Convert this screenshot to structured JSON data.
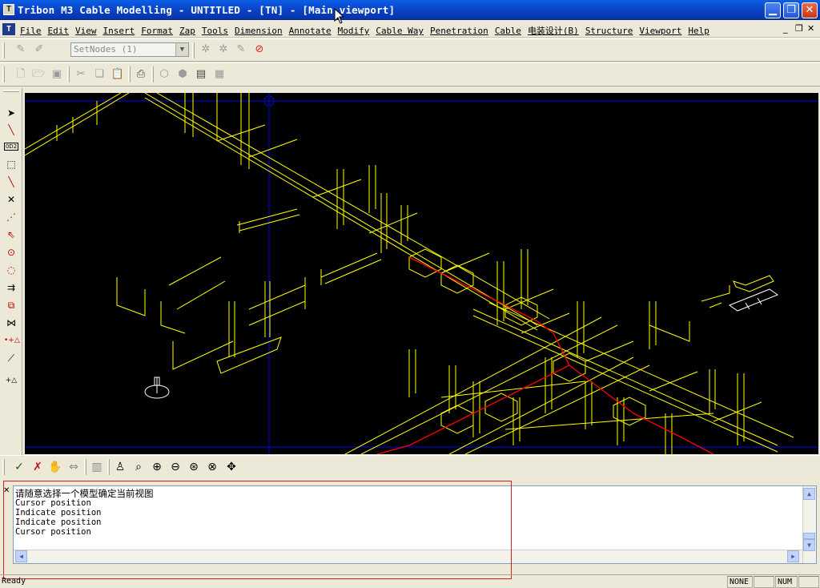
{
  "window": {
    "title": "Tribon M3 Cable Modelling - UNTITLED - [TN] - [Main viewport]",
    "minimize_label": "▁",
    "restore_label": "❐",
    "close_label": "✕"
  },
  "menubar": {
    "items": [
      "File",
      "Edit",
      "View",
      "Insert",
      "Format",
      "Zap",
      "Tools",
      "Dimension",
      "Annotate",
      "Modify",
      "Cable Way",
      "Penetration",
      "Cable",
      "电装设计(B)",
      "Structure",
      "Viewport",
      "Help"
    ],
    "mdi_min": "_",
    "mdi_restore": "❐",
    "mdi_close": "✕"
  },
  "toolbar1": {
    "setnodes_value": "SetNodes (1)",
    "icons": [
      "pencil-disabled-icon",
      "setnodes-dropdown",
      "gear-disabled-icon",
      "gear-disabled-icon-2",
      "pencil-disabled-icon-2",
      "stop-icon"
    ]
  },
  "toolbar2": {
    "icons": [
      "new-file-icon",
      "open-folder-icon",
      "save-icon",
      "cut-icon",
      "copy-icon",
      "paste-icon",
      "print-icon",
      "cube-icon",
      "cubes-icon",
      "properties-icon",
      "table-icon"
    ]
  },
  "left_tools": [
    "select-arrow-icon",
    "line-tool-icon",
    "dimension-icon",
    "box-icon",
    "line-diagonal-icon",
    "cross-icon",
    "node-icon",
    "node-arrow-icon",
    "point-circle-icon",
    "arc-icon",
    "arrows-icon",
    "rectangle-icon",
    "split-icon",
    "add-delta-icon",
    "wand-icon",
    "add-delta-icon-2"
  ],
  "bottom_toolbar": {
    "icons": [
      "ok-check-icon",
      "cancel-x-icon",
      "pan-hand-icon",
      "link-icon",
      "grid-icon",
      "brush-icon",
      "zoom-window-icon",
      "zoom-in-icon",
      "zoom-out-icon",
      "zoom-extents-icon",
      "zoom-previous-icon",
      "move-icon"
    ]
  },
  "command_log": {
    "lines": [
      "请随意选择一个模型确定当前视图",
      "Cursor position",
      "Indicate position",
      "Indicate position",
      "Cursor position"
    ]
  },
  "status": {
    "left": "Ready",
    "pane1": "NONE",
    "pane2": "",
    "pane3": "NUM",
    "pane4": ""
  },
  "colors": {
    "titlebar": "#0A3FC0",
    "viewport_bg": "#000000",
    "model_lines": "#FFFF00",
    "cable_route": "#FF0000",
    "axis_lines": "#0000CC",
    "highlight_box": "#D21E1E"
  }
}
